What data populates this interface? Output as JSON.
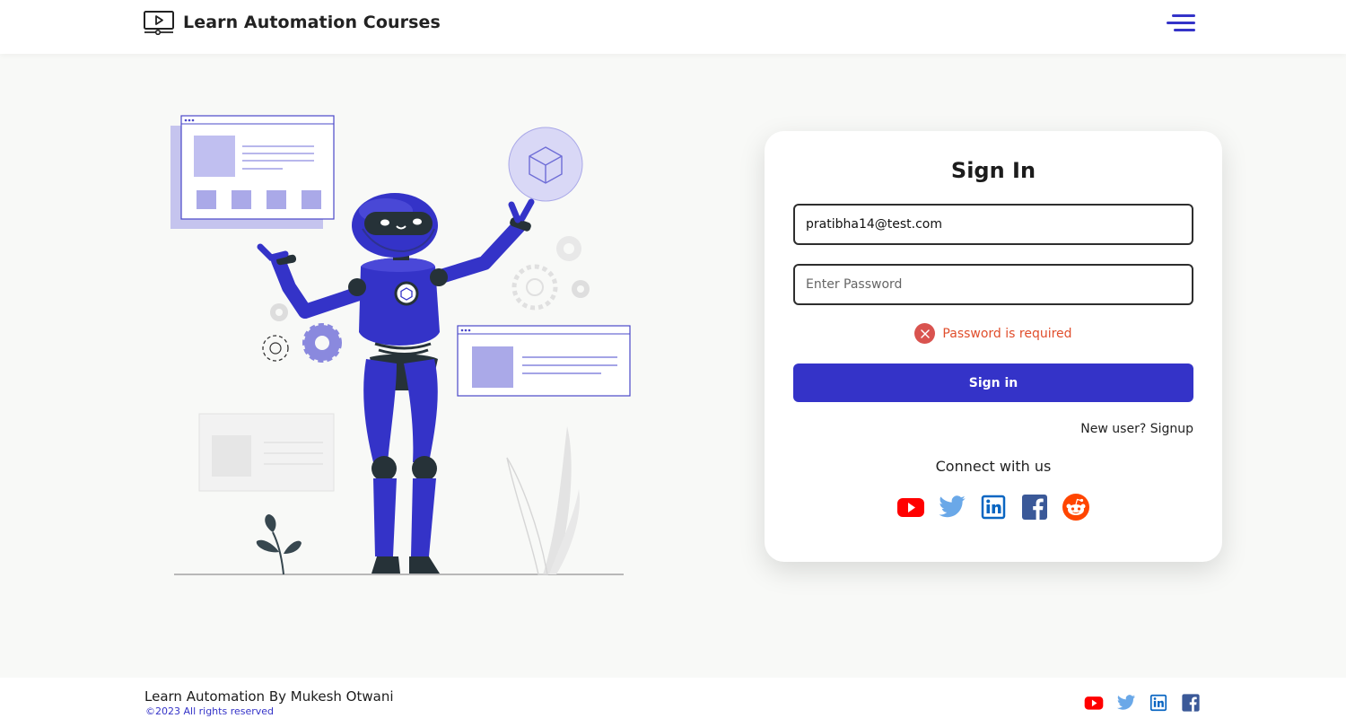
{
  "header": {
    "brand_title": "Learn Automation Courses",
    "brand_icon": "video-player-icon",
    "menu_icon": "hamburger-menu-icon"
  },
  "login": {
    "title": "Sign In",
    "email_value": "pratibha14@test.com",
    "password_placeholder": "Enter Password",
    "password_value": "",
    "error_message": "Password is required",
    "submit_label": "Sign in",
    "signup_link": "New user? Signup",
    "connect_label": "Connect with us",
    "social_icons": [
      "youtube-icon",
      "twitter-icon",
      "linkedin-icon",
      "facebook-icon",
      "reddit-icon"
    ]
  },
  "footer": {
    "title": "Learn Automation By Mukesh Otwani",
    "copyright": "©2023 All rights reserved",
    "social_icons": [
      "youtube-icon",
      "twitter-icon",
      "linkedin-icon",
      "facebook-icon"
    ]
  },
  "colors": {
    "accent": "#3433c8",
    "error": "#e04e2c",
    "page_bg": "#f8f9f7",
    "youtube": "#ff0000",
    "twitter": "#6aa8e8",
    "linkedin": "#0a66c2",
    "facebook": "#3b5998",
    "reddit": "#ff4500"
  }
}
